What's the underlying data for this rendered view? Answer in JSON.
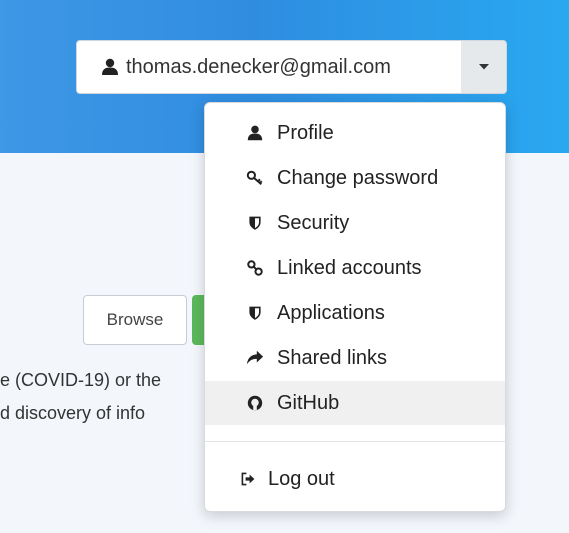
{
  "header": {
    "user_email": "thomas.denecker@gmail.com",
    "user_icon": "user-icon",
    "caret_icon": "caret-down-icon",
    "band_color": "#3a93e4"
  },
  "background": {
    "browse_label": "Browse",
    "text_line1": "e (COVID-19) or the",
    "text_line2": "d discovery of info",
    "accent_green": "#5cb85c"
  },
  "menu": {
    "items": [
      {
        "label": "Profile",
        "icon": "user-icon"
      },
      {
        "label": "Change password",
        "icon": "key-icon"
      },
      {
        "label": "Security",
        "icon": "shield-icon"
      },
      {
        "label": "Linked accounts",
        "icon": "link-icon"
      },
      {
        "label": "Applications",
        "icon": "shield-icon"
      },
      {
        "label": "Shared links",
        "icon": "share-icon"
      },
      {
        "label": "GitHub",
        "icon": "github-icon"
      }
    ],
    "logout": {
      "label": "Log out",
      "icon": "sign-out-icon"
    },
    "hover_color": "#f0f0f0"
  }
}
